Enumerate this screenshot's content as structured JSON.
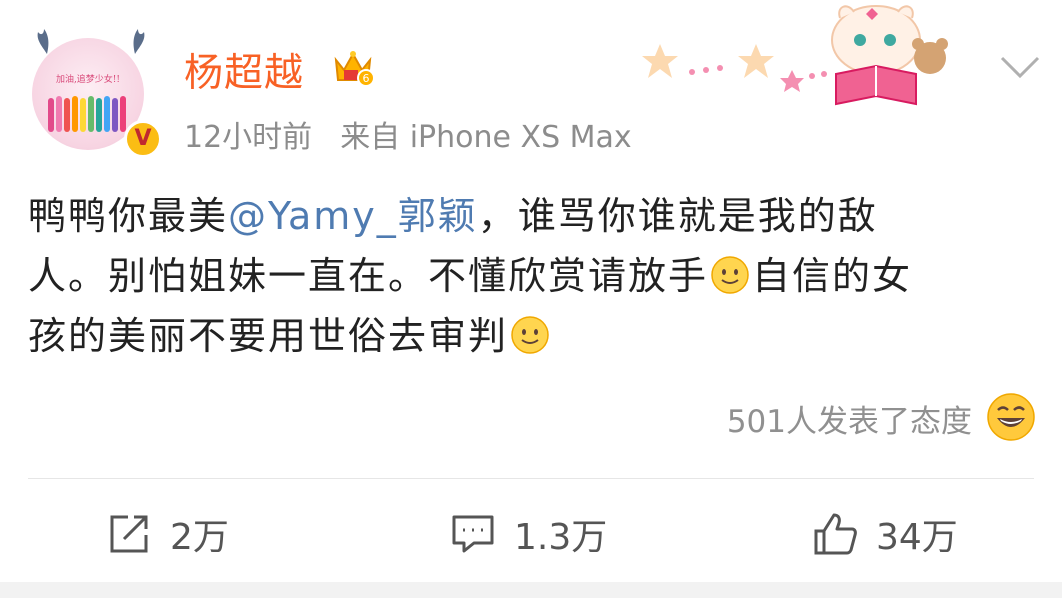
{
  "post": {
    "author": "杨超越",
    "time": "12小时前",
    "source": "来自 iPhone XS Max",
    "avatar_text": "加油,追梦少女!!",
    "verified_badge": "V",
    "content": {
      "line1_a": "鸭鸭你最美",
      "mention": "@Yamy_郭颖",
      "line1_b": "，谁骂你谁就是我的敌",
      "line2_a": "人。别怕姐妹一直在。不懂欣赏请放手",
      "line2_b": "自信的女",
      "line3_a": "孩的美丽不要用世俗去审判"
    },
    "reaction_text": "501人发表了态度"
  },
  "actions": {
    "repost_count": "2万",
    "comment_count": "1.3万",
    "like_count": "34万"
  },
  "colors": {
    "username": "#f86125",
    "mention": "#4f7bb1",
    "meta": "#8c8c8c",
    "badge": "#fbbd14"
  },
  "icons": [
    "chevron-down-icon",
    "vip-crown-icon",
    "smile-emoji-icon",
    "laugh-emoji-icon",
    "repost-icon",
    "comment-icon",
    "like-icon"
  ]
}
